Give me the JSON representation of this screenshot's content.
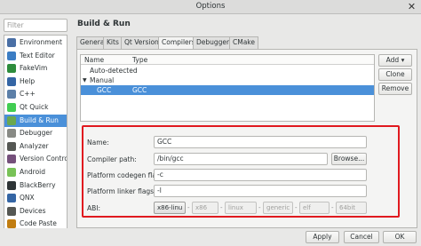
{
  "window": {
    "title": "Options",
    "close_glyph": "✕"
  },
  "filter": {
    "placeholder": "Filter"
  },
  "categories": [
    {
      "label": "Environment",
      "icon": "monitor-icon",
      "color": "#4a6fa5"
    },
    {
      "label": "Text Editor",
      "icon": "text-editor-icon",
      "color": "#3b7dc4"
    },
    {
      "label": "FakeVim",
      "icon": "fakevim-icon",
      "color": "#2d8c3c"
    },
    {
      "label": "Help",
      "icon": "help-icon",
      "color": "#3465a4"
    },
    {
      "label": "C++",
      "icon": "cpp-icon",
      "color": "#5c7fa8"
    },
    {
      "label": "Qt Quick",
      "icon": "qt-quick-icon",
      "color": "#41cd52"
    },
    {
      "label": "Build & Run",
      "icon": "build-run-icon",
      "color": "#6aa84f",
      "selected": true
    },
    {
      "label": "Debugger",
      "icon": "debugger-icon",
      "color": "#888a85"
    },
    {
      "label": "Analyzer",
      "icon": "analyzer-icon",
      "color": "#555753"
    },
    {
      "label": "Version Control",
      "icon": "version-control-icon",
      "color": "#75507b"
    },
    {
      "label": "Android",
      "icon": "android-icon",
      "color": "#78c257"
    },
    {
      "label": "BlackBerry",
      "icon": "blackberry-icon",
      "color": "#2e3436"
    },
    {
      "label": "QNX",
      "icon": "qnx-icon",
      "color": "#3465a4"
    },
    {
      "label": "Devices",
      "icon": "devices-icon",
      "color": "#555753"
    },
    {
      "label": "Code Paste",
      "icon": "code-paste-icon",
      "color": "#c17d11"
    }
  ],
  "page": {
    "title": "Build & Run"
  },
  "tabs": [
    {
      "label": "General",
      "active": false
    },
    {
      "label": "Kits",
      "active": false
    },
    {
      "label": "Qt Versions",
      "active": false
    },
    {
      "label": "Compilers",
      "active": true
    },
    {
      "label": "Debuggers",
      "active": false
    },
    {
      "label": "CMake",
      "active": false
    }
  ],
  "tree": {
    "columns": [
      "Name",
      "Type"
    ],
    "rows": [
      {
        "name": "Auto-detected",
        "type": ""
      },
      {
        "name": "Manual",
        "type": "",
        "expanded": true
      },
      {
        "name": "GCC",
        "type": "GCC",
        "selected": true
      }
    ],
    "arrow_glyph": "▼"
  },
  "side_buttons": {
    "add": "Add",
    "add_arrow": "▾",
    "clone": "Clone",
    "remove": "Remove"
  },
  "form": {
    "name_label": "Name:",
    "name_value": "GCC",
    "path_label": "Compiler path:",
    "path_value": "/bin/gcc",
    "browse": "Browse...",
    "codegen_label": "Platform codegen flags:",
    "codegen_value": "-c",
    "linker_label": "Platform linker flags:",
    "linker_value": "-l",
    "abi_label": "ABI:",
    "abi_parts": [
      "x86-linu",
      "x86",
      "linux",
      "generic",
      "elf",
      "64bit"
    ]
  },
  "footer": {
    "apply": "Apply",
    "cancel": "Cancel",
    "ok": "OK"
  }
}
